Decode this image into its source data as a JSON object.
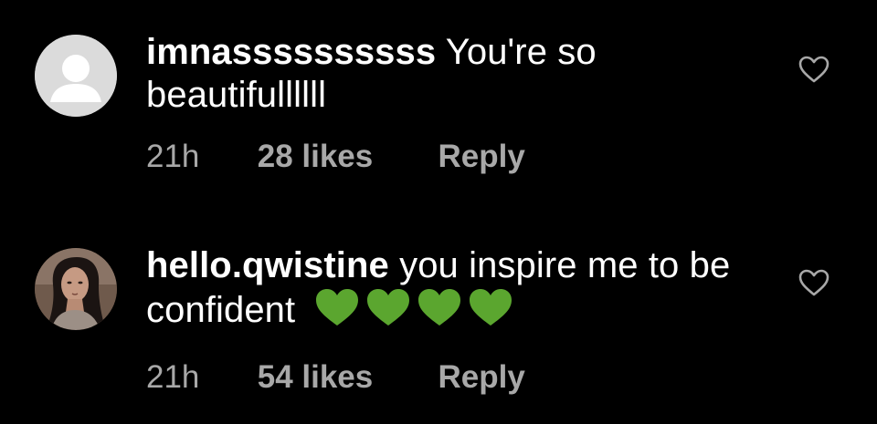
{
  "comments": [
    {
      "username": "imnassssssssss",
      "text": "You're so beautifullllll",
      "time": "21h",
      "likes": "28 likes",
      "reply_label": "Reply",
      "avatar": "default-avatar-icon",
      "emoji": []
    },
    {
      "username": "hello.qwistine",
      "text": "you inspire me to be confident",
      "time": "21h",
      "likes": "54 likes",
      "reply_label": "Reply",
      "avatar": "profile-photo",
      "emoji": [
        "green-heart-emoji",
        "green-heart-emoji",
        "green-heart-emoji",
        "green-heart-emoji"
      ]
    }
  ],
  "colors": {
    "background": "#000000",
    "text": "#ffffff",
    "secondary_text": "#a8a8a8",
    "heart_green": "#5ba62f",
    "default_avatar": "#dbdbdb"
  },
  "icons": {
    "like": "heart-outline-icon"
  }
}
